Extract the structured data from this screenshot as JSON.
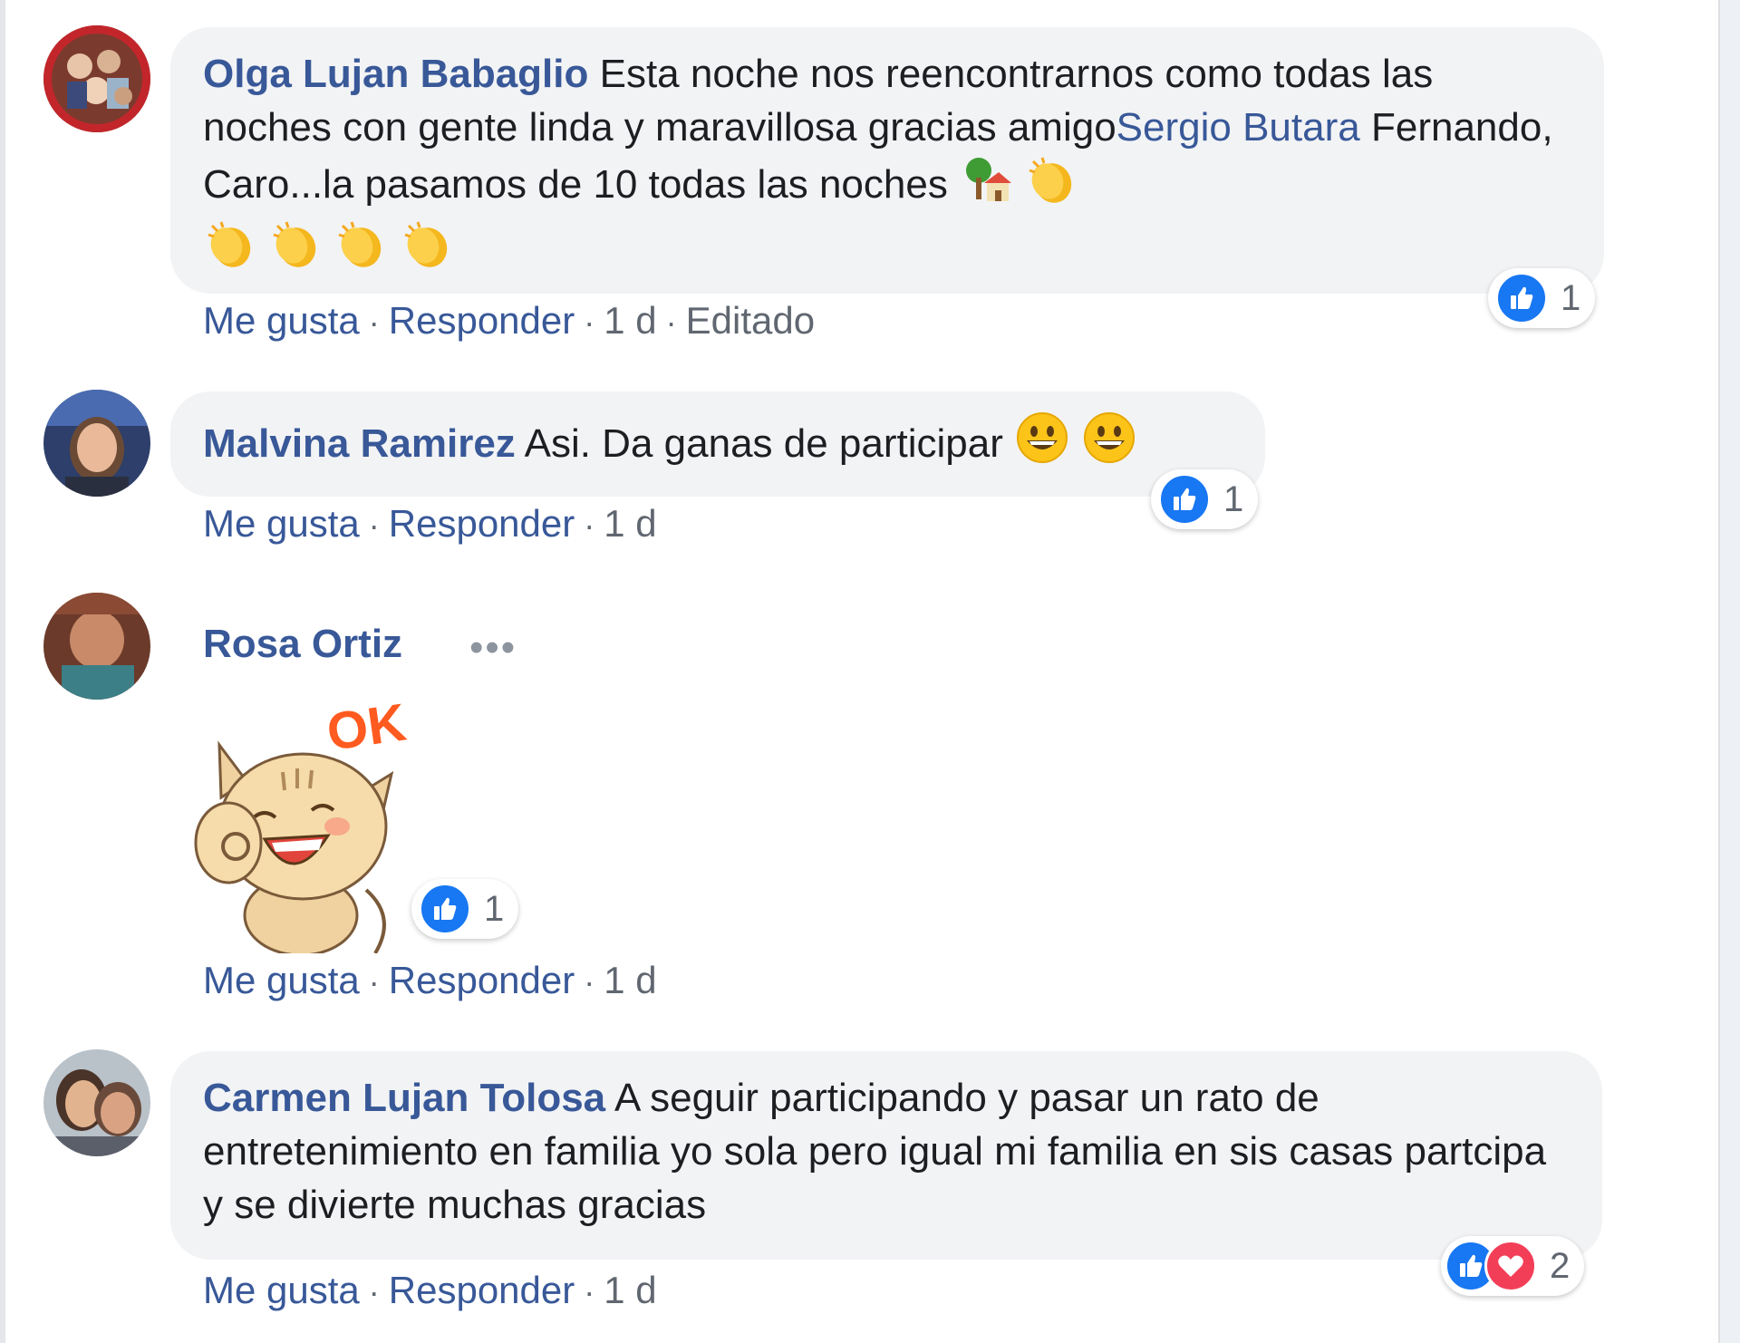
{
  "comments": [
    {
      "author": "Olga Lujan Babaglio",
      "text_before_mention": "Esta noche nos reencontrarnos como todas las noches con gente linda y maravillosa gracias amigo",
      "mention": "Sergio Butara",
      "text_after_mention": "Fernando, Caro...la pasamos de 10 todas las noches",
      "emojis": [
        "tree-house-emoji",
        "clapping-hands-emoji",
        "clapping-hands-emoji",
        "clapping-hands-emoji",
        "clapping-hands-emoji",
        "clapping-hands-emoji"
      ],
      "reactions": {
        "types": [
          "like"
        ],
        "count": "1"
      },
      "actions": {
        "like": "Me gusta",
        "reply": "Responder",
        "time": "1 d",
        "edited": "Editado"
      }
    },
    {
      "author": "Malvina Ramirez",
      "text": "Asi. Da ganas de participar",
      "emojis": [
        "grinning-face-emoji",
        "grinning-face-emoji"
      ],
      "reactions": {
        "types": [
          "like"
        ],
        "count": "1"
      },
      "actions": {
        "like": "Me gusta",
        "reply": "Responder",
        "time": "1 d"
      }
    },
    {
      "author": "Rosa Ortiz",
      "more_menu": "•••",
      "sticker": {
        "name": "ok-cat-sticker",
        "text": "OK"
      },
      "reactions": {
        "types": [
          "like"
        ],
        "count": "1"
      },
      "actions": {
        "like": "Me gusta",
        "reply": "Responder",
        "time": "1 d"
      }
    },
    {
      "author": "Carmen Lujan Tolosa",
      "text": "A seguir participando y pasar un rato de entretenimiento en familia yo sola pero igual mi familia en sis casas partcipa y se divierte muchas gracias",
      "reactions": {
        "types": [
          "like",
          "love"
        ],
        "count": "2"
      },
      "actions": {
        "like": "Me gusta",
        "reply": "Responder",
        "time": "1 d"
      }
    }
  ],
  "separator": "·",
  "colors": {
    "link": "#385898",
    "bubble": "#f2f3f5",
    "like": "#1877f2",
    "love": "#f33e58",
    "meta": "#606770"
  }
}
